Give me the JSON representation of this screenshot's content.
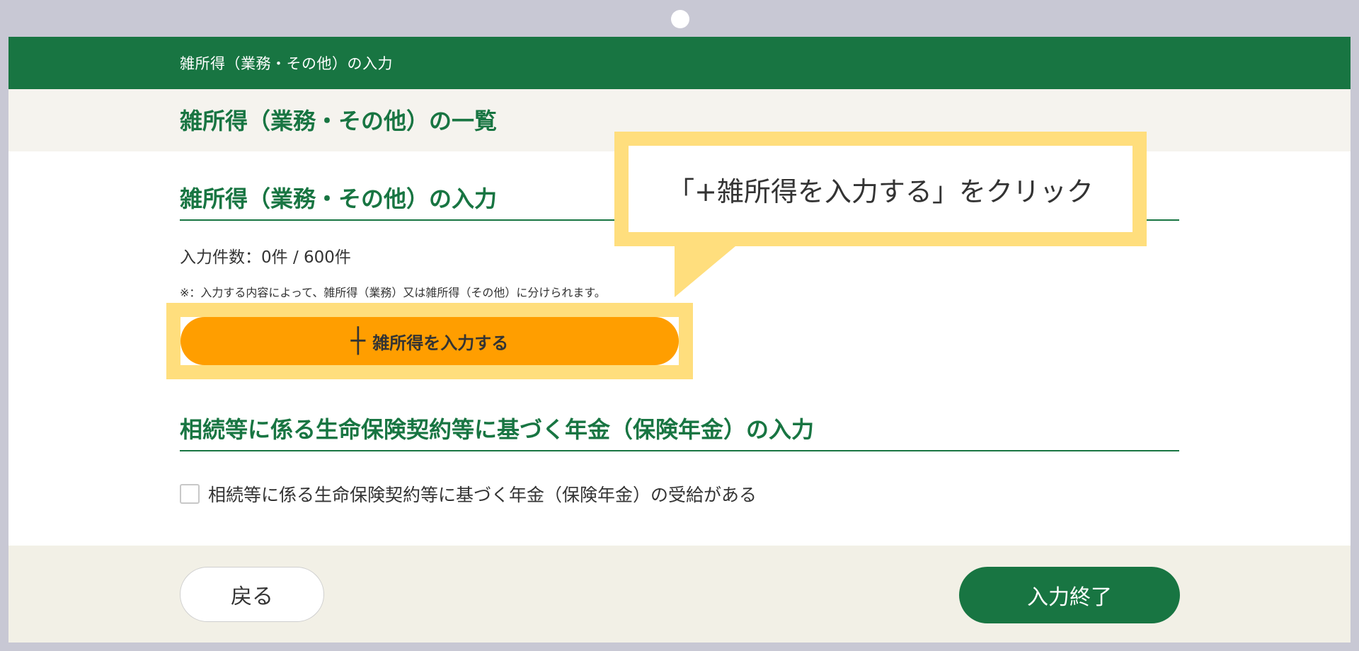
{
  "header": {
    "title": "雑所得（業務・その他）の入力"
  },
  "list_section": {
    "heading": "雑所得（業務・その他）の一覧"
  },
  "input_section": {
    "heading": "雑所得（業務・その他）の入力",
    "count_text": "入力件数：0件 / 600件",
    "note": "※：入力する内容によって、雑所得（業務）又は雑所得（その他）に分けられます。",
    "add_button_label": "雑所得を入力する",
    "add_button_icon": "plus-icon"
  },
  "callout": {
    "text": "「+雑所得を入力する」をクリック"
  },
  "insurance_section": {
    "heading": "相続等に係る生命保険契約等に基づく年金（保険年金）の入力",
    "checkbox_label": "相続等に係る生命保険契約等に基づく年金（保険年金）の受給がある",
    "checkbox_checked": false
  },
  "footer": {
    "back_label": "戻る",
    "finish_label": "入力終了"
  },
  "colors": {
    "primary_green": "#187542",
    "add_button_orange": "#ff9e00",
    "highlight_yellow": "#ffde7d",
    "frame": "#c8c8d4"
  }
}
